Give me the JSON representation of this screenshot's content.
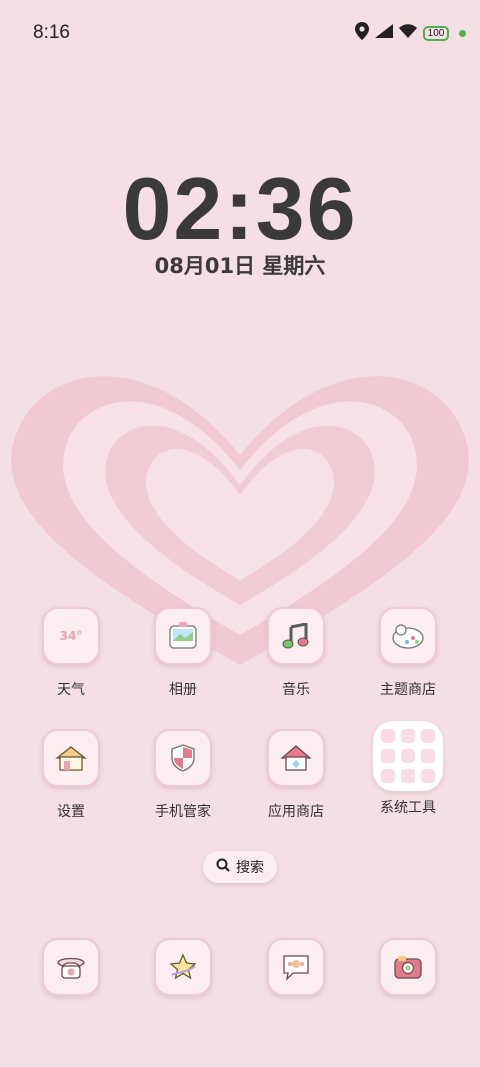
{
  "status_bar": {
    "time": "8:16",
    "battery": "100",
    "icons": [
      "location-icon",
      "signal-icon",
      "wifi-icon",
      "battery-icon",
      "charging-dot-icon"
    ]
  },
  "lockclock": {
    "time": "02:36",
    "date": "08月01日 星期六"
  },
  "apps": [
    {
      "id": "weather",
      "label": "天气",
      "icon": "weather-icon",
      "tile_text": "34°"
    },
    {
      "id": "album",
      "label": "相册",
      "icon": "album-icon"
    },
    {
      "id": "music",
      "label": "音乐",
      "icon": "music-icon"
    },
    {
      "id": "theme-store",
      "label": "主题商店",
      "icon": "theme-store-icon"
    },
    {
      "id": "settings",
      "label": "设置",
      "icon": "settings-icon"
    },
    {
      "id": "phone-manager",
      "label": "手机管家",
      "icon": "shield-icon"
    },
    {
      "id": "app-store",
      "label": "应用商店",
      "icon": "app-store-icon"
    },
    {
      "id": "system-tools",
      "label": "系统工具",
      "icon": "folder-icon"
    }
  ],
  "search": {
    "label": "搜索"
  },
  "dock": [
    {
      "id": "phone",
      "icon": "phone-icon"
    },
    {
      "id": "browser",
      "icon": "star-icon"
    },
    {
      "id": "messages",
      "icon": "message-icon"
    },
    {
      "id": "camera",
      "icon": "camera-icon"
    }
  ],
  "colors": {
    "background": "#f3dfe4",
    "tile": "#fbeef1",
    "accent": "#e89aa8",
    "charging": "#4caf50"
  }
}
